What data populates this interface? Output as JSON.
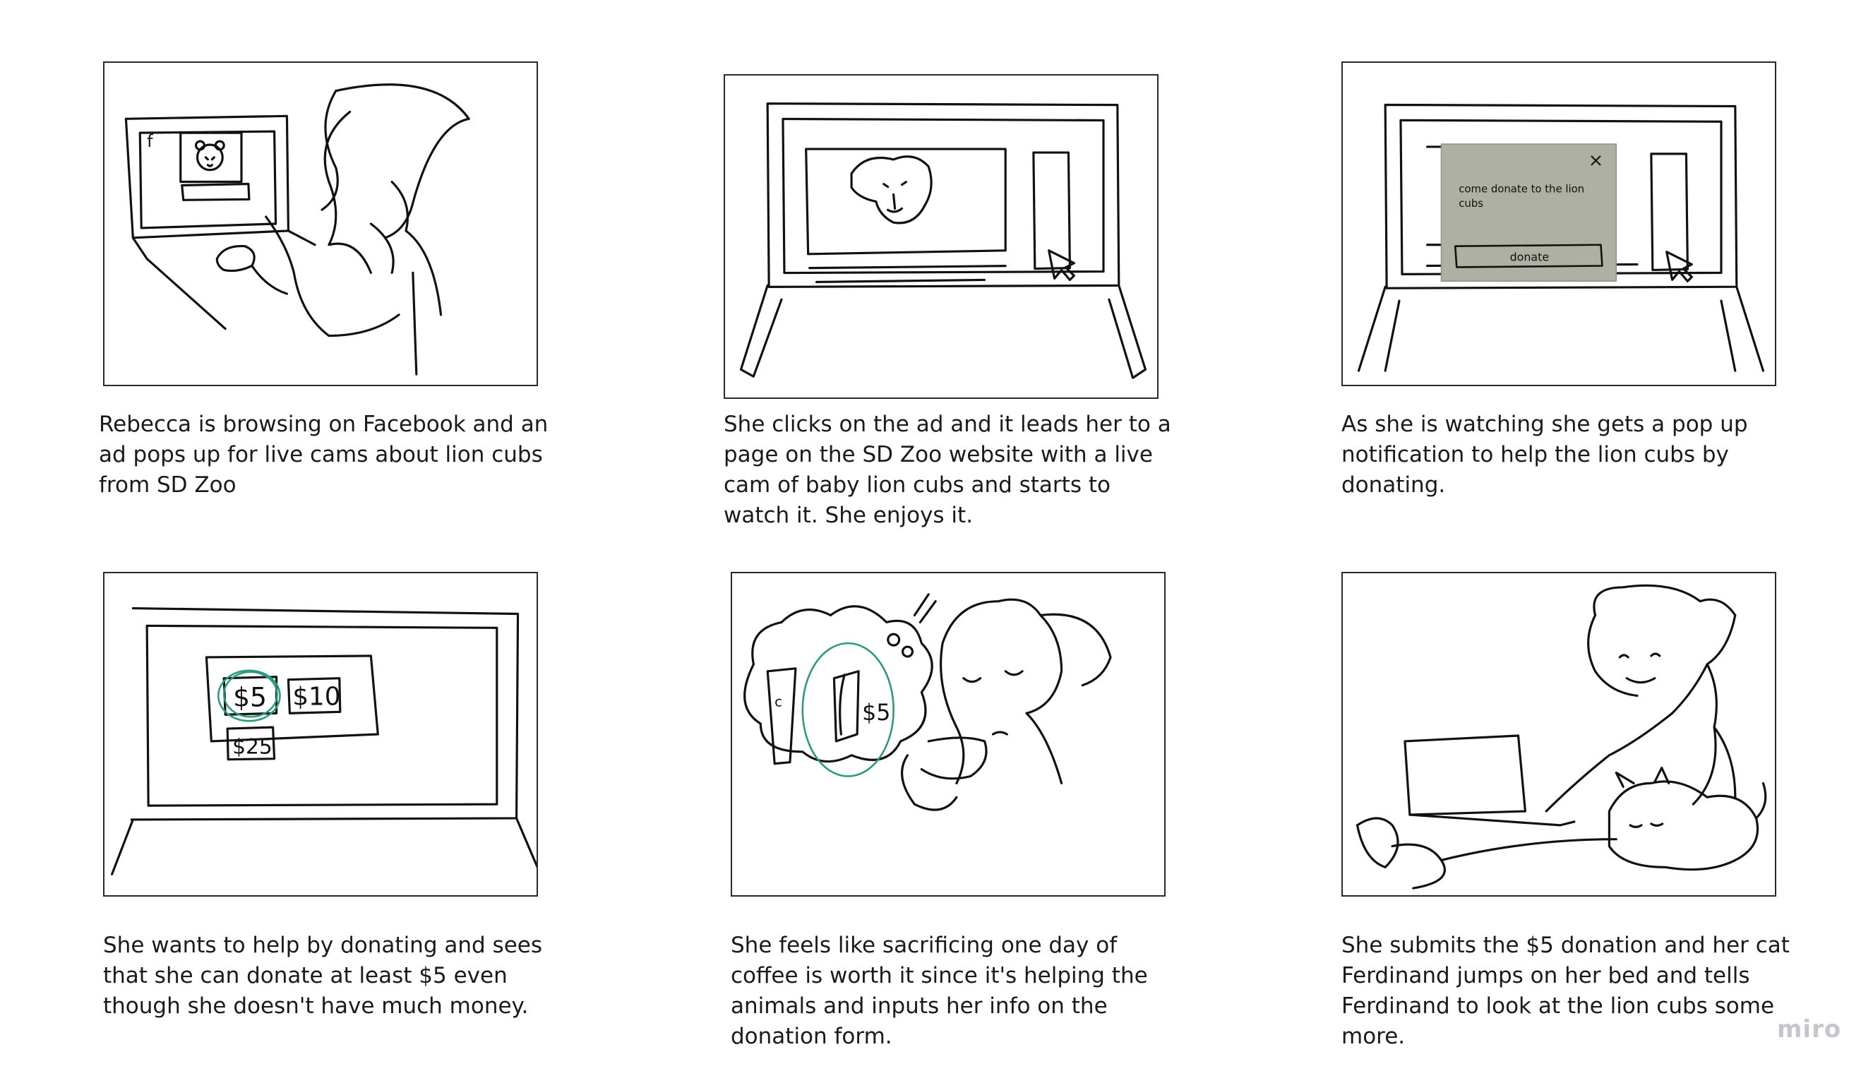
{
  "panels": [
    {
      "caption": "Rebecca is browsing on Facebook and an ad pops up for live cams about lion cubs from SD Zoo",
      "sketch": "woman-browsing-facebook"
    },
    {
      "caption": "She clicks on the ad and it leads her to a page on the SD Zoo website with a live cam of baby lion cubs and starts to watch it. She enjoys it.",
      "sketch": "laptop-live-cam"
    },
    {
      "caption": "As she is watching she gets a pop up notification to help the lion cubs by donating.",
      "sketch": "laptop-popup",
      "popup": {
        "message": "come donate to the lion cubs",
        "button": "donate",
        "close": "×"
      }
    },
    {
      "caption": "She wants to help by donating and sees that she can donate at least $5 even though she doesn't have much money.",
      "sketch": "donation-options",
      "amounts": [
        "$5",
        "$10",
        "$25"
      ]
    },
    {
      "caption": "She feels like sacrificing one day of coffee is worth it since it's helping the animals and inputs her info on the donation form.",
      "sketch": "thinking-coffee",
      "bubble_text": "$5",
      "cup_label": "c"
    },
    {
      "caption": "She submits the $5 donation and her cat Ferdinand jumps on her bed and tells Ferdinand to look at the lion cubs some more.",
      "sketch": "woman-with-cat"
    }
  ],
  "brand": "miro",
  "colors": {
    "teal_circle": "#2a9a80",
    "popup_bg": "#aeb0a3",
    "brand_text": "#c4c6cc"
  }
}
